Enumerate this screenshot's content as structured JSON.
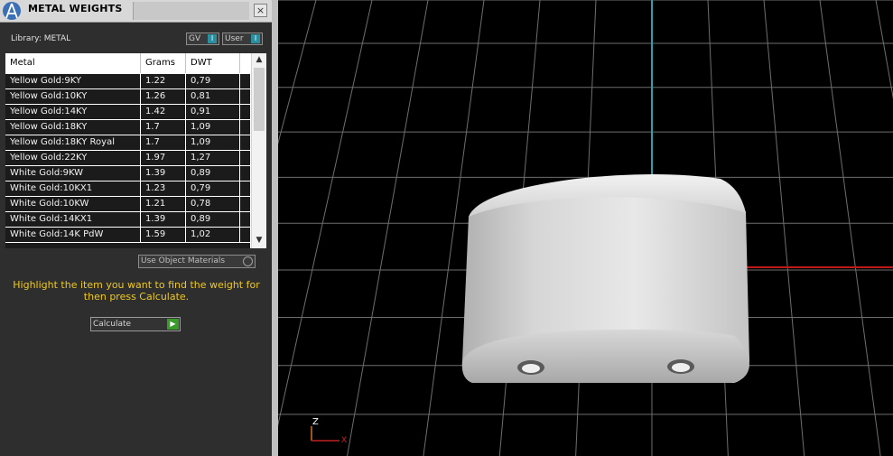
{
  "panel": {
    "title": "METAL WEIGHTS",
    "close_glyph": "×",
    "library_label": "Library: METAL",
    "gv_label": "GV",
    "user_label": "User",
    "toggle_mark": "I",
    "columns": [
      "Metal",
      "Grams",
      "DWT"
    ],
    "rows": [
      {
        "metal": "Yellow Gold:9KY",
        "grams": "1.22",
        "dwt": "0,79"
      },
      {
        "metal": "Yellow Gold:10KY",
        "grams": "1.26",
        "dwt": "0,81"
      },
      {
        "metal": "Yellow Gold:14KY",
        "grams": "1.42",
        "dwt": "0,91"
      },
      {
        "metal": "Yellow Gold:18KY",
        "grams": "1.7",
        "dwt": "1,09"
      },
      {
        "metal": "Yellow Gold:18KY Royal",
        "grams": "1.7",
        "dwt": "1,09"
      },
      {
        "metal": "Yellow Gold:22KY",
        "grams": "1.97",
        "dwt": "1,27"
      },
      {
        "metal": "White Gold:9KW",
        "grams": "1.39",
        "dwt": "0,89"
      },
      {
        "metal": "White Gold:10KX1",
        "grams": "1.23",
        "dwt": "0,79"
      },
      {
        "metal": "White Gold:10KW",
        "grams": "1.21",
        "dwt": "0,78"
      },
      {
        "metal": "White Gold:14KX1",
        "grams": "1.39",
        "dwt": "0,89"
      },
      {
        "metal": "White Gold:14K PdW",
        "grams": "1.59",
        "dwt": "1,02"
      }
    ],
    "use_object_materials": "Use Object Materials",
    "instruction": "Highlight the item you want to find the weight for then press Calculate.",
    "calculate_label": "Calculate",
    "calculate_arrow": "▶"
  },
  "viewport": {
    "axis_z_label": "Z",
    "axis_x_label": "X",
    "colors": {
      "grid": "#6e6e6e",
      "axis_y": "#2aa0b0",
      "axis_x": "#c01818",
      "object": "#d8d8d8"
    }
  }
}
